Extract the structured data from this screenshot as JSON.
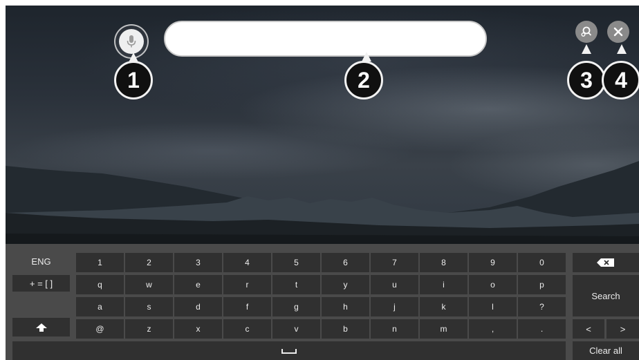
{
  "callouts": [
    "1",
    "2",
    "3",
    "4"
  ],
  "search": {
    "value": "",
    "placeholder": ""
  },
  "icons": {
    "mic": "microphone-icon",
    "search_history": "search-history-icon",
    "close": "close-icon",
    "shift": "shift-arrow-icon",
    "backspace": "backspace-icon",
    "space": "space-bar-icon"
  },
  "keyboard": {
    "language": "ENG",
    "symbols": "+ = [ ]",
    "row_numbers": [
      "1",
      "2",
      "3",
      "4",
      "5",
      "6",
      "7",
      "8",
      "9",
      "0"
    ],
    "row_top": [
      "q",
      "w",
      "e",
      "r",
      "t",
      "y",
      "u",
      "i",
      "o",
      "p"
    ],
    "row_middle": [
      "a",
      "s",
      "d",
      "f",
      "g",
      "h",
      "j",
      "k",
      "l",
      "?"
    ],
    "row_bottom": [
      "@",
      "z",
      "x",
      "c",
      "v",
      "b",
      "n",
      "m",
      ",",
      "."
    ],
    "search_label": "Search",
    "cursor_left": "<",
    "cursor_right": ">",
    "clear_all_label": "Clear all"
  },
  "colors": {
    "keyboard_bg": "#4a4a4a",
    "key_bg": "#303030",
    "key_text": "#ececec",
    "callout_bg": "#101010"
  }
}
